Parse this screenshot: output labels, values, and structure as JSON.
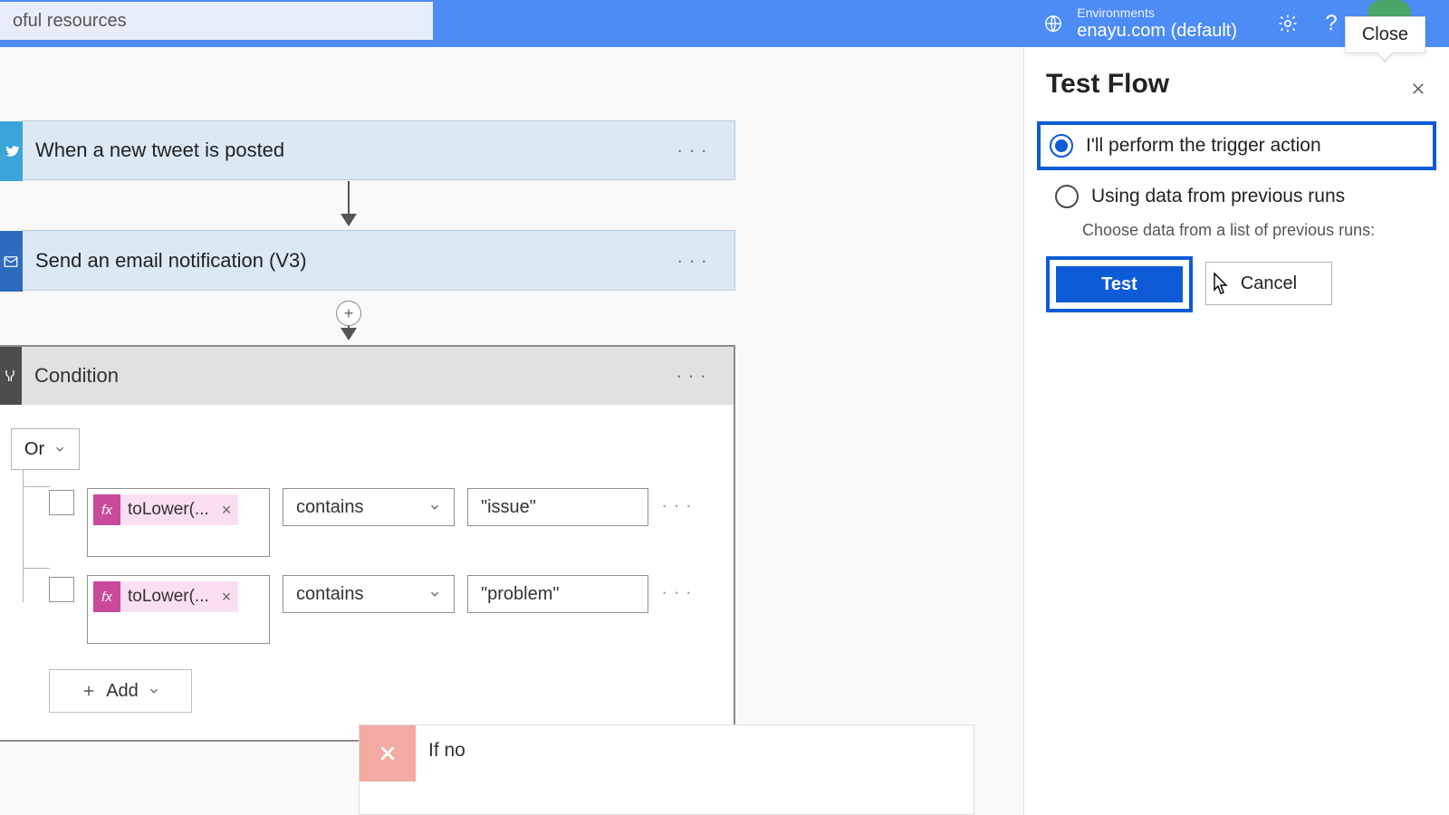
{
  "topbar": {
    "search_text": "oful resources",
    "env_label": "Environments",
    "env_name": "enayu.com (default)"
  },
  "tooltip": {
    "close": "Close"
  },
  "cards": {
    "trigger": "When a new tweet is posted",
    "email": "Send an email notification (V3)"
  },
  "condition": {
    "title": "Condition",
    "group_operator": "Or",
    "rows": [
      {
        "token": "toLower(...",
        "operator": "contains",
        "value": "\"issue\""
      },
      {
        "token": "toLower(...",
        "operator": "contains",
        "value": "\"problem\""
      }
    ],
    "add_label": "Add"
  },
  "ifno": {
    "label": "If no"
  },
  "panel": {
    "title": "Test Flow",
    "option1": "I'll perform the trigger action",
    "option2": "Using data from previous runs",
    "option2_hint": "Choose data from a list of previous runs:",
    "test_btn": "Test",
    "cancel_btn": "Cancel"
  }
}
